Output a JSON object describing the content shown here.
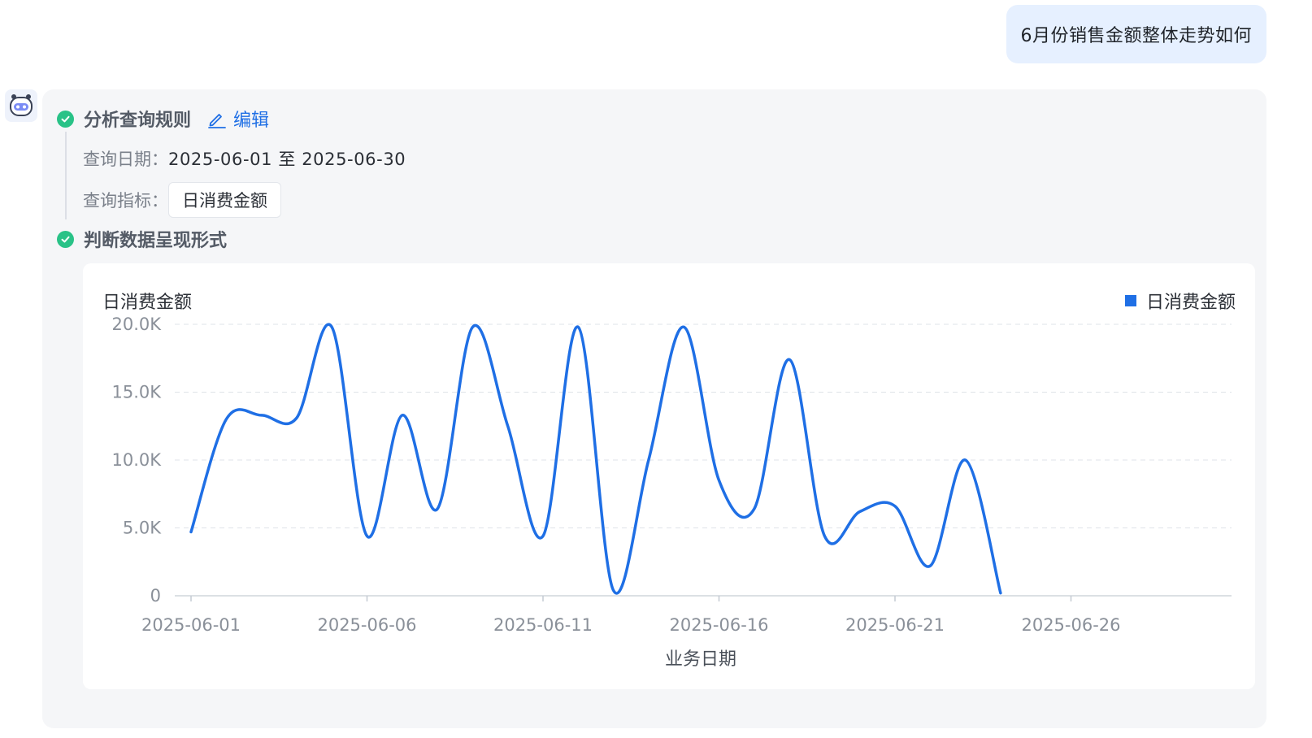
{
  "user_message": "6月份销售金额整体走势如何",
  "steps": {
    "step1": {
      "title": "分析查询规则",
      "edit_label": "编辑"
    },
    "rules": {
      "date_label": "查询日期：",
      "date_value": "2025-06-01 至 2025-06-30",
      "metric_label": "查询指标：",
      "metric_value": "日消费金额"
    },
    "step2": {
      "title": "判断数据呈现形式"
    }
  },
  "colors": {
    "accent": "#1f6fe5",
    "success": "#29c287",
    "bubble": "#e6f0ff",
    "card": "#f5f6f8"
  },
  "chart_data": {
    "type": "line",
    "title": "日消费金额",
    "xlabel": "业务日期",
    "ylabel": "日消费金额",
    "legend": "top-right",
    "grid": true,
    "smooth": true,
    "ylim": [
      0,
      20000
    ],
    "yticks": [
      0,
      5000,
      10000,
      15000,
      20000
    ],
    "ytick_labels": [
      "0",
      "5.0K",
      "10.0K",
      "15.0K",
      "20.0K"
    ],
    "xlim": [
      "2025-06-01",
      "2025-06-30"
    ],
    "xtick_labels": [
      "2025-06-01",
      "2025-06-06",
      "2025-06-11",
      "2025-06-16",
      "2025-06-21",
      "2025-06-26"
    ],
    "x": [
      "2025-06-01",
      "2025-06-02",
      "2025-06-03",
      "2025-06-04",
      "2025-06-05",
      "2025-06-06",
      "2025-06-07",
      "2025-06-08",
      "2025-06-09",
      "2025-06-10",
      "2025-06-11",
      "2025-06-12",
      "2025-06-13",
      "2025-06-14",
      "2025-06-15",
      "2025-06-16",
      "2025-06-17",
      "2025-06-18",
      "2025-06-19",
      "2025-06-20",
      "2025-06-21",
      "2025-06-22",
      "2025-06-23",
      "2025-06-24"
    ],
    "series": [
      {
        "name": "日消费金额",
        "values": [
          4700,
          13000,
          13300,
          13100,
          19800,
          4400,
          13300,
          6400,
          19800,
          12500,
          4400,
          19800,
          400,
          10000,
          19800,
          8500,
          6400,
          17400,
          4400,
          6200,
          6600,
          2200,
          10000,
          200
        ]
      }
    ]
  }
}
